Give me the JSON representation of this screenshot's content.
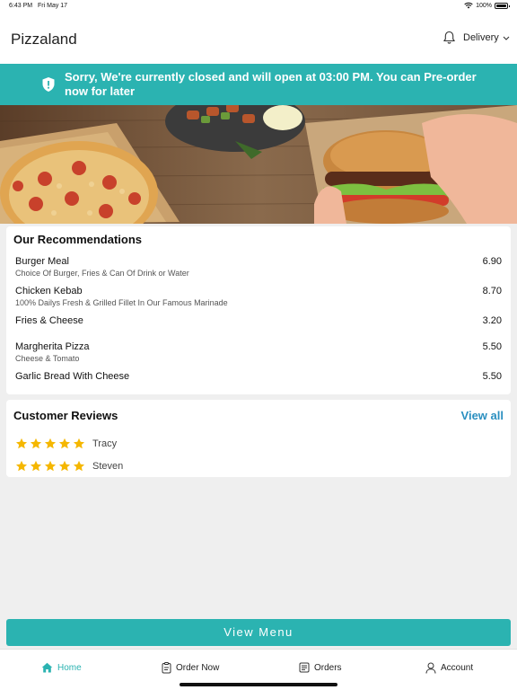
{
  "status_bar": {
    "time": "6:43 PM",
    "date": "Fri May 17",
    "battery": "100%"
  },
  "header": {
    "title": "Pizzaland",
    "mode_label": "Delivery"
  },
  "banner": {
    "message": "Sorry, We're currently closed and will open at 03:00 PM. You can Pre-order now for later"
  },
  "recommendations": {
    "title": "Our Recommendations",
    "items": [
      {
        "name": "Burger Meal",
        "desc": "Choice Of Burger, Fries & Can Of Drink or Water",
        "price": "6.90"
      },
      {
        "name": "Chicken Kebab",
        "desc": "100% Dailys Fresh & Grilled Fillet In Our Famous Marinade",
        "price": "8.70"
      },
      {
        "name": "Fries & Cheese",
        "desc": "",
        "price": "3.20"
      },
      {
        "name": "Margherita Pizza",
        "desc": "Cheese & Tomato",
        "price": "5.50"
      },
      {
        "name": "Garlic Bread With Cheese",
        "desc": "",
        "price": "5.50"
      }
    ]
  },
  "reviews": {
    "title": "Customer Reviews",
    "view_all": "View all",
    "items": [
      {
        "name": "Tracy",
        "rating": 5
      },
      {
        "name": "Steven",
        "rating": 5
      }
    ]
  },
  "view_menu_label": "View Menu",
  "tabbar": {
    "home": "Home",
    "order_now": "Order Now",
    "orders": "Orders",
    "account": "Account"
  },
  "colors": {
    "accent": "#2bb3b1",
    "link": "#2a8fc0",
    "star": "#f5b700"
  },
  "icons": [
    "bell-icon",
    "chevron-down-icon",
    "shield-icon",
    "star-icon",
    "home-icon",
    "order-now-icon",
    "orders-icon",
    "account-icon"
  ]
}
